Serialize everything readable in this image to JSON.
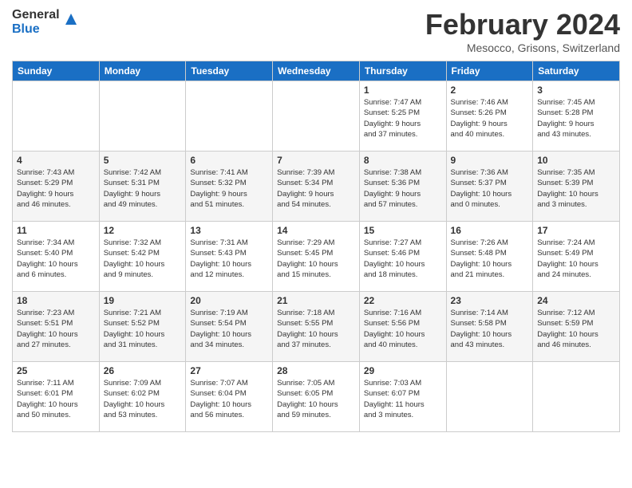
{
  "logo": {
    "general": "General",
    "blue": "Blue"
  },
  "title": "February 2024",
  "location": "Mesocco, Grisons, Switzerland",
  "days_of_week": [
    "Sunday",
    "Monday",
    "Tuesday",
    "Wednesday",
    "Thursday",
    "Friday",
    "Saturday"
  ],
  "weeks": [
    [
      {
        "day": "",
        "info": ""
      },
      {
        "day": "",
        "info": ""
      },
      {
        "day": "",
        "info": ""
      },
      {
        "day": "",
        "info": ""
      },
      {
        "day": "1",
        "info": "Sunrise: 7:47 AM\nSunset: 5:25 PM\nDaylight: 9 hours\nand 37 minutes."
      },
      {
        "day": "2",
        "info": "Sunrise: 7:46 AM\nSunset: 5:26 PM\nDaylight: 9 hours\nand 40 minutes."
      },
      {
        "day": "3",
        "info": "Sunrise: 7:45 AM\nSunset: 5:28 PM\nDaylight: 9 hours\nand 43 minutes."
      }
    ],
    [
      {
        "day": "4",
        "info": "Sunrise: 7:43 AM\nSunset: 5:29 PM\nDaylight: 9 hours\nand 46 minutes."
      },
      {
        "day": "5",
        "info": "Sunrise: 7:42 AM\nSunset: 5:31 PM\nDaylight: 9 hours\nand 49 minutes."
      },
      {
        "day": "6",
        "info": "Sunrise: 7:41 AM\nSunset: 5:32 PM\nDaylight: 9 hours\nand 51 minutes."
      },
      {
        "day": "7",
        "info": "Sunrise: 7:39 AM\nSunset: 5:34 PM\nDaylight: 9 hours\nand 54 minutes."
      },
      {
        "day": "8",
        "info": "Sunrise: 7:38 AM\nSunset: 5:36 PM\nDaylight: 9 hours\nand 57 minutes."
      },
      {
        "day": "9",
        "info": "Sunrise: 7:36 AM\nSunset: 5:37 PM\nDaylight: 10 hours\nand 0 minutes."
      },
      {
        "day": "10",
        "info": "Sunrise: 7:35 AM\nSunset: 5:39 PM\nDaylight: 10 hours\nand 3 minutes."
      }
    ],
    [
      {
        "day": "11",
        "info": "Sunrise: 7:34 AM\nSunset: 5:40 PM\nDaylight: 10 hours\nand 6 minutes."
      },
      {
        "day": "12",
        "info": "Sunrise: 7:32 AM\nSunset: 5:42 PM\nDaylight: 10 hours\nand 9 minutes."
      },
      {
        "day": "13",
        "info": "Sunrise: 7:31 AM\nSunset: 5:43 PM\nDaylight: 10 hours\nand 12 minutes."
      },
      {
        "day": "14",
        "info": "Sunrise: 7:29 AM\nSunset: 5:45 PM\nDaylight: 10 hours\nand 15 minutes."
      },
      {
        "day": "15",
        "info": "Sunrise: 7:27 AM\nSunset: 5:46 PM\nDaylight: 10 hours\nand 18 minutes."
      },
      {
        "day": "16",
        "info": "Sunrise: 7:26 AM\nSunset: 5:48 PM\nDaylight: 10 hours\nand 21 minutes."
      },
      {
        "day": "17",
        "info": "Sunrise: 7:24 AM\nSunset: 5:49 PM\nDaylight: 10 hours\nand 24 minutes."
      }
    ],
    [
      {
        "day": "18",
        "info": "Sunrise: 7:23 AM\nSunset: 5:51 PM\nDaylight: 10 hours\nand 27 minutes."
      },
      {
        "day": "19",
        "info": "Sunrise: 7:21 AM\nSunset: 5:52 PM\nDaylight: 10 hours\nand 31 minutes."
      },
      {
        "day": "20",
        "info": "Sunrise: 7:19 AM\nSunset: 5:54 PM\nDaylight: 10 hours\nand 34 minutes."
      },
      {
        "day": "21",
        "info": "Sunrise: 7:18 AM\nSunset: 5:55 PM\nDaylight: 10 hours\nand 37 minutes."
      },
      {
        "day": "22",
        "info": "Sunrise: 7:16 AM\nSunset: 5:56 PM\nDaylight: 10 hours\nand 40 minutes."
      },
      {
        "day": "23",
        "info": "Sunrise: 7:14 AM\nSunset: 5:58 PM\nDaylight: 10 hours\nand 43 minutes."
      },
      {
        "day": "24",
        "info": "Sunrise: 7:12 AM\nSunset: 5:59 PM\nDaylight: 10 hours\nand 46 minutes."
      }
    ],
    [
      {
        "day": "25",
        "info": "Sunrise: 7:11 AM\nSunset: 6:01 PM\nDaylight: 10 hours\nand 50 minutes."
      },
      {
        "day": "26",
        "info": "Sunrise: 7:09 AM\nSunset: 6:02 PM\nDaylight: 10 hours\nand 53 minutes."
      },
      {
        "day": "27",
        "info": "Sunrise: 7:07 AM\nSunset: 6:04 PM\nDaylight: 10 hours\nand 56 minutes."
      },
      {
        "day": "28",
        "info": "Sunrise: 7:05 AM\nSunset: 6:05 PM\nDaylight: 10 hours\nand 59 minutes."
      },
      {
        "day": "29",
        "info": "Sunrise: 7:03 AM\nSunset: 6:07 PM\nDaylight: 11 hours\nand 3 minutes."
      },
      {
        "day": "",
        "info": ""
      },
      {
        "day": "",
        "info": ""
      }
    ]
  ]
}
